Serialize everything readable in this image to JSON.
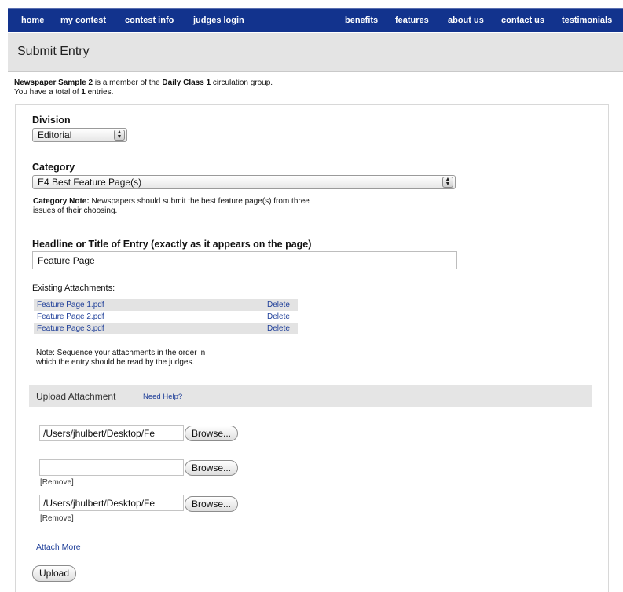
{
  "nav": {
    "left": [
      "home",
      "my contest",
      "contest info",
      "judges login"
    ],
    "right": [
      "benefits",
      "features",
      "about us",
      "contact us",
      "testimonials"
    ]
  },
  "page_title": "Submit Entry",
  "intro": {
    "paper": "Newspaper Sample 2",
    "member_text": " is a member of the ",
    "group": "Daily Class 1",
    "group_suffix": " circulation group.",
    "total_prefix": "You have a total of ",
    "total_count": "1",
    "total_suffix": " entries."
  },
  "division": {
    "label": "Division",
    "value": "Editorial"
  },
  "category": {
    "label": "Category",
    "value": "E4 Best Feature Page(s)",
    "note_label": "Category Note:",
    "note_line1": " Newspapers should submit the best feature page(s) from three",
    "note_line2": "issues of their choosing."
  },
  "headline": {
    "label": "Headline or Title of Entry (exactly as it appears on the page)",
    "value": "Feature Page"
  },
  "attachments": {
    "label": "Existing Attachments:",
    "items": [
      {
        "name": "Feature Page 1.pdf",
        "action": "Delete"
      },
      {
        "name": "Feature Page 2.pdf",
        "action": "Delete"
      },
      {
        "name": "Feature Page 3.pdf",
        "action": "Delete"
      }
    ],
    "note_line1": "Note: Sequence your attachments in the order in",
    "note_line2": "which the entry should be read by the judges."
  },
  "upload": {
    "title": "Upload Attachment",
    "help": "Need Help?",
    "files": [
      {
        "value": "/Users/jhulbert/Desktop/Fe",
        "remove": ""
      },
      {
        "value": "",
        "remove": "[Remove]"
      },
      {
        "value": "/Users/jhulbert/Desktop/Fe",
        "remove": "[Remove]"
      }
    ],
    "browse_label": "Browse...",
    "attach_more": "Attach More",
    "upload_button": "Upload"
  }
}
